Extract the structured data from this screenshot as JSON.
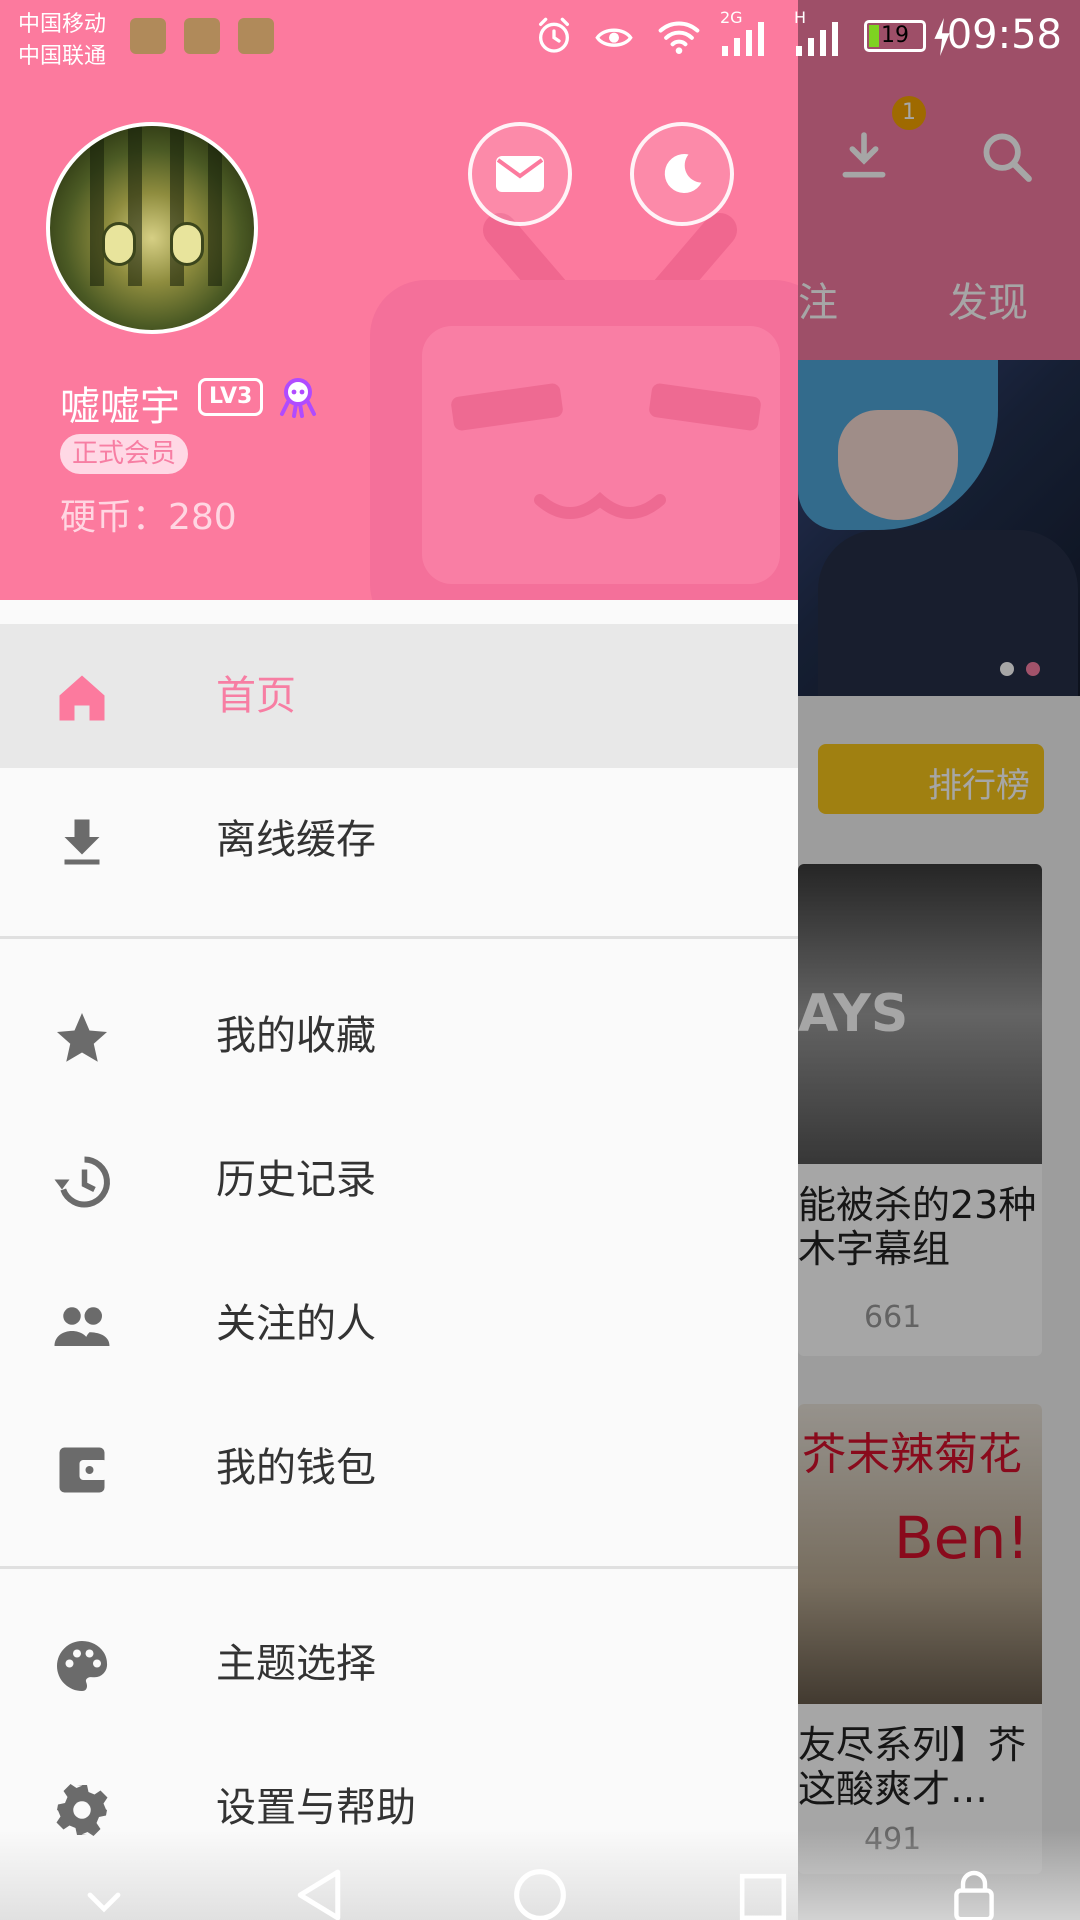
{
  "status_bar": {
    "carrier_1": "中国移动",
    "carrier_2": "中国联通",
    "network_1": "2G",
    "network_2": "H",
    "battery": "19",
    "battery_level": 0.19,
    "time": "09:58"
  },
  "background_app": {
    "download_badge": "1",
    "tabs": [
      "关注",
      "发现"
    ],
    "rank_label": "排行榜",
    "cards": [
      {
        "title_line_1": "能被杀的23种",
        "title_line_2": "木字幕组",
        "count": "661"
      },
      {
        "title_line_1": "友尽系列】芥",
        "title_line_2": "这酸爽才…",
        "count": "491"
      }
    ],
    "card_2_overlay": "芥末辣菊花",
    "card_2_overlay_2": "Ben!",
    "card_1_overlay": "AYS"
  },
  "profile": {
    "username": "嘘嘘宇",
    "level": "LV3",
    "member_status": "正式会员",
    "coins": "硬币：280"
  },
  "menu": {
    "items": [
      {
        "label": "首页",
        "icon": "home-icon",
        "active": true
      },
      {
        "label": "离线缓存",
        "icon": "download-icon"
      },
      {
        "label": "我的收藏",
        "icon": "star-icon"
      },
      {
        "label": "历史记录",
        "icon": "history-icon"
      },
      {
        "label": "关注的人",
        "icon": "people-icon"
      },
      {
        "label": "我的钱包",
        "icon": "wallet-icon"
      },
      {
        "label": "主题选择",
        "icon": "palette-icon"
      },
      {
        "label": "设置与帮助",
        "icon": "settings-icon"
      }
    ]
  },
  "colors": {
    "accent": "#fc7a9e",
    "active_text": "#f77ea3",
    "icon_gray": "#6b6b6b",
    "active_bg": "#e8e8e8"
  }
}
